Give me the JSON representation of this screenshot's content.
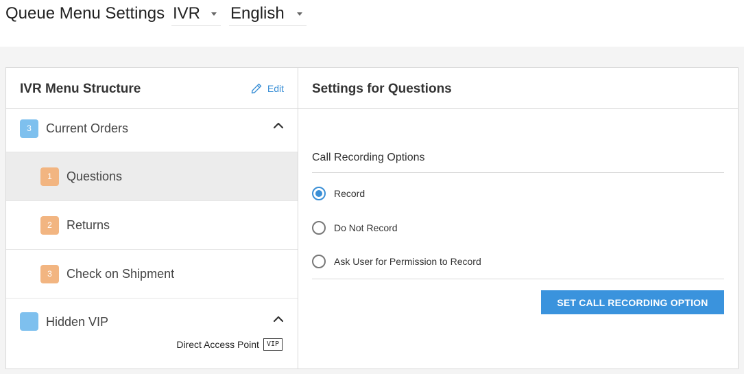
{
  "header": {
    "title": "Queue Menu Settings",
    "queue_select": "IVR",
    "language_select": "English"
  },
  "left_panel": {
    "title": "IVR Menu Structure",
    "edit_label": "Edit",
    "tree": [
      {
        "badge": "3",
        "label": "Current Orders",
        "color": "#7ec0ee",
        "expanded": true
      },
      {
        "badge": "1",
        "label": "Questions",
        "color": "#f2b581",
        "selected": true
      },
      {
        "badge": "2",
        "label": "Returns",
        "color": "#f2b581"
      },
      {
        "badge": "3",
        "label": "Check on Shipment",
        "color": "#f2b581"
      },
      {
        "badge": "",
        "label": "Hidden VIP",
        "color": "#7ec0ee",
        "expanded": true,
        "access_point_label": "Direct Access Point",
        "access_tag": "VIP"
      }
    ]
  },
  "right_panel": {
    "title": "Settings for Questions",
    "section_label": "Call Recording Options",
    "options": [
      {
        "label": "Record",
        "checked": true
      },
      {
        "label": "Do Not Record",
        "checked": false
      },
      {
        "label": "Ask User for Permission to Record",
        "checked": false
      }
    ],
    "button_label": "SET CALL RECORDING OPTION"
  },
  "colors": {
    "accent": "#3a8fd6",
    "button": "#3a93dd",
    "badge_blue": "#7ec0ee",
    "badge_orange": "#f2b581"
  },
  "icons": {
    "edit": "pencil-icon",
    "collapse": "chevron-up-icon",
    "dropdown": "caret-down-icon"
  }
}
